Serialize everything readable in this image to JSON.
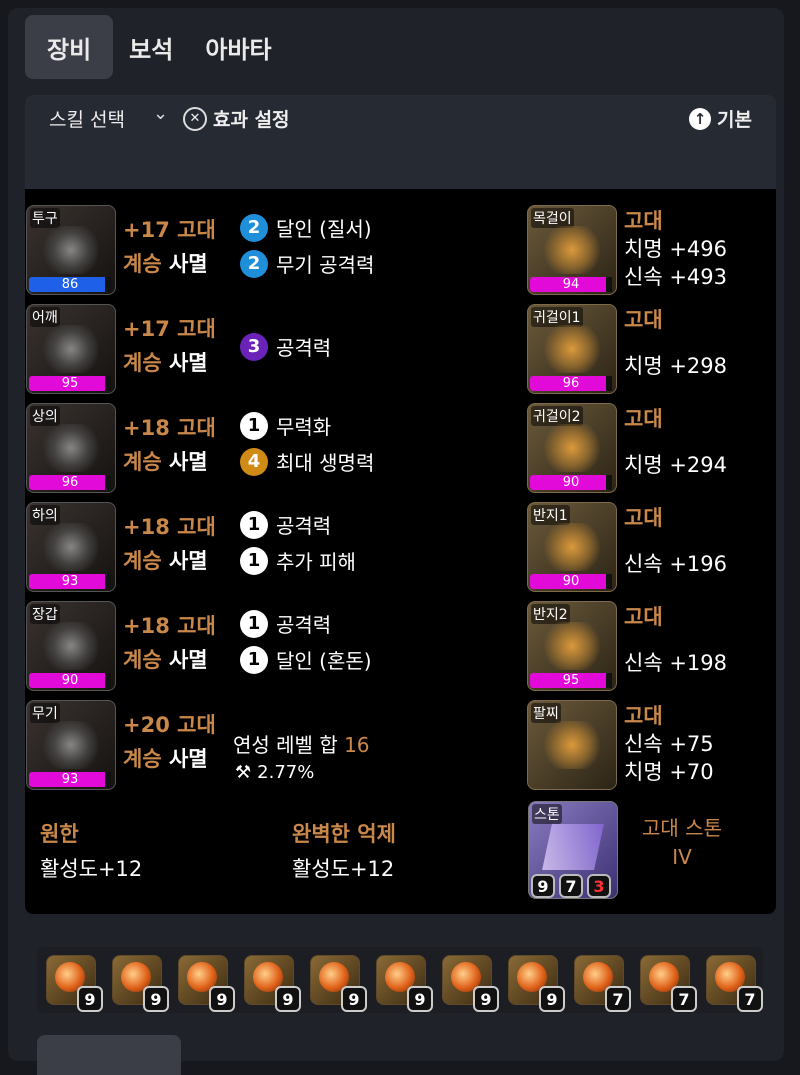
{
  "tabs": [
    "장비",
    "보석",
    "아바타"
  ],
  "skill_bar": {
    "select_label": "스킬 선택",
    "effect_label": "효과 설정",
    "basic_label": "기본"
  },
  "equipment": [
    {
      "slot": "투구",
      "quality": 86,
      "quality_color": "#1f60e8",
      "grade": "+17 고대",
      "inherit_key": "계승",
      "inherit_val": "사멸",
      "engravings": [
        {
          "level": 2,
          "name": "달인 (질서)"
        },
        {
          "level": 2,
          "name": "무기 공격력"
        }
      ]
    },
    {
      "slot": "어깨",
      "quality": 95,
      "quality_color": "#e20ad8",
      "grade": "+17 고대",
      "inherit_key": "계승",
      "inherit_val": "사멸",
      "engravings": [
        {
          "level": 3,
          "name": "공격력"
        }
      ]
    },
    {
      "slot": "상의",
      "quality": 96,
      "quality_color": "#e20ad8",
      "grade": "+18 고대",
      "inherit_key": "계승",
      "inherit_val": "사멸",
      "engravings": [
        {
          "level": 1,
          "name": "무력화"
        },
        {
          "level": 4,
          "name": "최대 생명력"
        }
      ]
    },
    {
      "slot": "하의",
      "quality": 93,
      "quality_color": "#e20ad8",
      "grade": "+18 고대",
      "inherit_key": "계승",
      "inherit_val": "사멸",
      "engravings": [
        {
          "level": 1,
          "name": "공격력"
        },
        {
          "level": 1,
          "name": "추가 피해"
        }
      ]
    },
    {
      "slot": "장갑",
      "quality": 90,
      "quality_color": "#e20ad8",
      "grade": "+18 고대",
      "inherit_key": "계승",
      "inherit_val": "사멸",
      "engravings": [
        {
          "level": 1,
          "name": "공격력"
        },
        {
          "level": 1,
          "name": "달인 (혼돈)"
        }
      ]
    },
    {
      "slot": "무기",
      "quality": 93,
      "quality_color": "#e20ad8",
      "grade": "+20 고대",
      "inherit_key": "계승",
      "inherit_val": "사멸"
    }
  ],
  "transcend": {
    "label": "연성 레벨 합",
    "sum": "16",
    "percent": "2.77%"
  },
  "elixir": [
    {
      "name": "원한",
      "value": "활성도+12"
    },
    {
      "name": "완벽한 억제",
      "value": "활성도+12"
    }
  ],
  "accessories": [
    {
      "slot": "목걸이",
      "quality": 94,
      "grade": "고대",
      "stats": [
        "치명 +496",
        "신속 +493"
      ]
    },
    {
      "slot": "귀걸이1",
      "quality": 96,
      "grade": "고대",
      "stats": [
        "치명 +298"
      ]
    },
    {
      "slot": "귀걸이2",
      "quality": 90,
      "grade": "고대",
      "stats": [
        "치명 +294"
      ]
    },
    {
      "slot": "반지1",
      "quality": 90,
      "grade": "고대",
      "stats": [
        "신속 +196"
      ]
    },
    {
      "slot": "반지2",
      "quality": 95,
      "grade": "고대",
      "stats": [
        "신속 +198"
      ]
    },
    {
      "slot": "팔찌",
      "grade": "고대",
      "stats": [
        "신속 +75",
        "치명 +70"
      ]
    }
  ],
  "stone": {
    "slot": "스톤",
    "name_line1": "고대 스톤",
    "name_line2": "IV",
    "nums": [
      "9",
      "7",
      "3"
    ]
  },
  "gems": [
    "9",
    "9",
    "9",
    "9",
    "9",
    "9",
    "9",
    "9",
    "7",
    "7",
    "7"
  ],
  "colors": {
    "accent": "#c9884a",
    "quality_pink": "#e20ad8",
    "quality_blue": "#1f60e8",
    "background": "#000000"
  }
}
